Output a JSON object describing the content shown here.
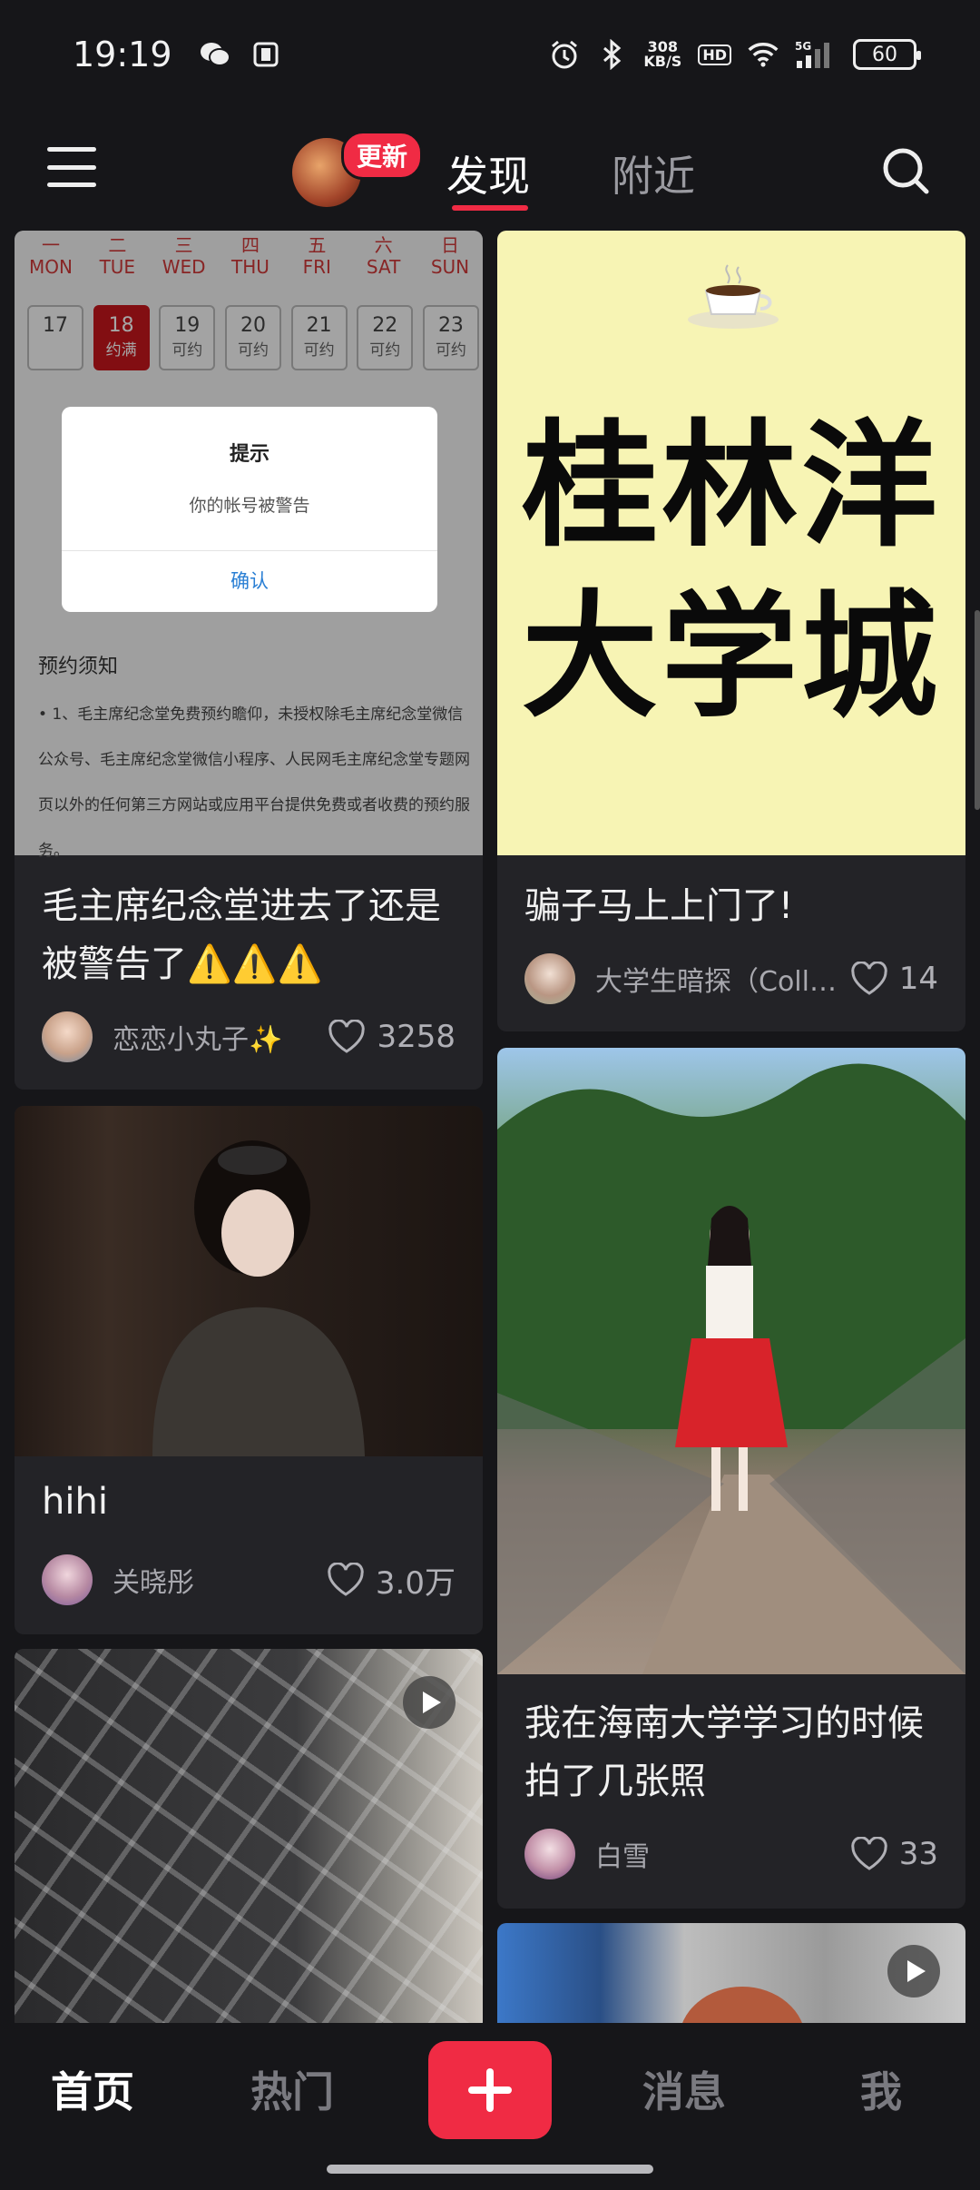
{
  "status_bar": {
    "time": "19:19",
    "net_speed_value": "308",
    "net_speed_unit": "KB/S",
    "hd_label": "HD",
    "signal_label": "5G",
    "battery": "60"
  },
  "top_nav": {
    "update_badge": "更新",
    "tabs": [
      {
        "label": "发现",
        "active": true
      },
      {
        "label": "附近",
        "active": false
      }
    ]
  },
  "feed": {
    "card1": {
      "weekdays": [
        {
          "cn": "一",
          "en": "MON"
        },
        {
          "cn": "二",
          "en": "TUE"
        },
        {
          "cn": "三",
          "en": "WED"
        },
        {
          "cn": "四",
          "en": "THU"
        },
        {
          "cn": "五",
          "en": "FRI"
        },
        {
          "cn": "六",
          "en": "SAT"
        },
        {
          "cn": "日",
          "en": "SUN"
        }
      ],
      "dates": [
        {
          "day": "17",
          "status": ""
        },
        {
          "day": "18",
          "status": "约满"
        },
        {
          "day": "19",
          "status": "可约"
        },
        {
          "day": "20",
          "status": "可约"
        },
        {
          "day": "21",
          "status": "可约"
        },
        {
          "day": "22",
          "status": "可约"
        },
        {
          "day": "23",
          "status": "可约"
        }
      ],
      "dialog_title": "提示",
      "dialog_message": "你的帐号被警告",
      "dialog_button": "确认",
      "notice_title": "预约须知",
      "notice_text": "• 1、毛主席纪念堂免费预约瞻仰，未授权除毛主席纪念堂微信公众号、毛主席纪念堂微信小程序、人民网毛主席纪念堂专题网页以外的任何第三方网站或应用平台提供免费或者收费的预约服务。",
      "title": "毛主席纪念堂进去了还是被警告了⚠️⚠️⚠️",
      "author": "恋恋小丸子✨",
      "likes": "3258"
    },
    "card2": {
      "poster_line1": "桂林洋",
      "poster_line2": "大学城",
      "title": "骗子马上上门了!",
      "author": "大学生暗探（Coll…",
      "likes": "14"
    },
    "card3": {
      "title": "hihi",
      "author": "关晓彤",
      "likes": "3.0万"
    },
    "card4": {
      "title": "我在海南大学学习的时候拍了几张照",
      "author": "白雪",
      "likes": "33"
    }
  },
  "bottom_nav": {
    "home": "首页",
    "hot": "热门",
    "messages": "消息",
    "me": "我"
  }
}
